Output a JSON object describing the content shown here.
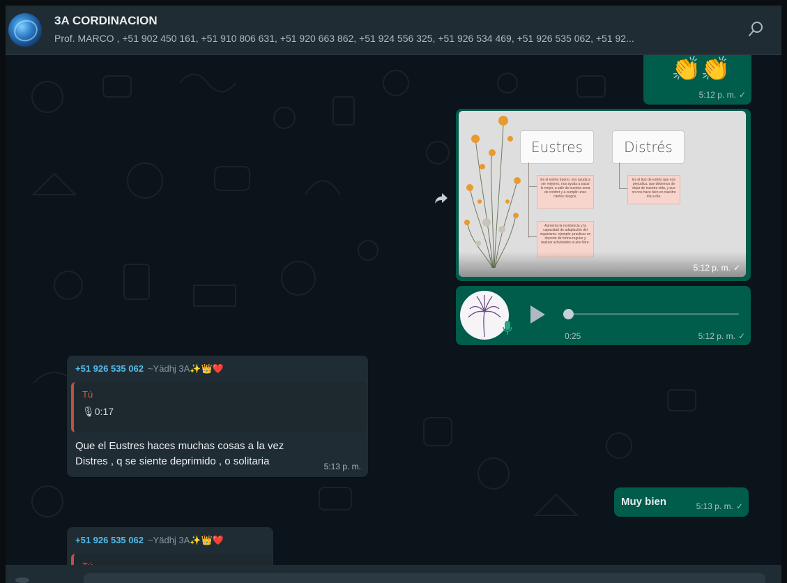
{
  "header": {
    "group_name": "3A CORDINACION",
    "members": "Prof. MARCO , +51 902 450 161, +51 910 806 631, +51 920 663 862, +51 924 556 325, +51 926 534 469, +51 926 535 062, +51 92...",
    "search_icon": "search-icon"
  },
  "messages": {
    "claps": {
      "emoji": "👏👏",
      "time": "5:12 p. m.",
      "status": "✓"
    },
    "image": {
      "time": "5:12 p. m.",
      "status": "✓",
      "slide": {
        "box_left": "Eustres",
        "box_right": "Distrés",
        "note_left_1": "Es el estrés bueno, nos ayuda a ser mejores, nos ayuda a sacar lo mejor, a salir de nuestra zona de confort y a cumplir unos ciertos riesgos.",
        "note_left_2": "Aumenta la resistencia y la capacidad de adaptación del organismo. ejemplo: practicar un deporte de forma regular y realizar actividades al aire libre.",
        "note_right": "Es el tipo de estrés que nos perjudica, que debemos de dejar de nuestra vida, y que no nos hace bien en nuestro día a día."
      }
    },
    "audio_out": {
      "duration": "0:25",
      "time": "5:12 p. m.",
      "status": "✓"
    },
    "reply_1": {
      "sender_phone": "+51 926 535 062",
      "sender_nick": "~Yädhj 3A✨👑❤️",
      "quote_author": "Tú",
      "quote_audio": "🎙0:17",
      "text_line_1": "Que el Eustres haces  muchas cosas a la vez",
      "text_line_2": "Distres , q se siente deprimido , o solitaria",
      "time": "5:13 p. m."
    },
    "muy_bien": {
      "text": "Muy bien",
      "time": "5:13 p. m.",
      "status": "✓"
    },
    "reply_2": {
      "sender_phone": "+51 926 535 062",
      "sender_nick": "~Yädhj 3A✨👑❤️",
      "quote_author": "Tú"
    }
  },
  "colors": {
    "outgoing_bubble": "#005c4b",
    "incoming_bubble": "#202c33",
    "sender_phone": "#53bdeb",
    "quote_accent": "#c0513f",
    "background": "#0b141a"
  }
}
